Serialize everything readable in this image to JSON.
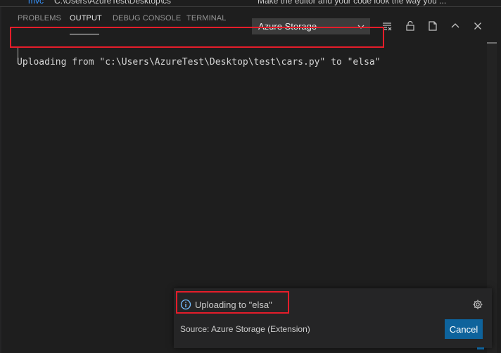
{
  "background_editor": {
    "project_name": "mvc",
    "project_path": "C:\\Users\\AzureTest\\Desktop\\cs",
    "tip_text": "Make the editor and your code look the way you ..."
  },
  "panel": {
    "tabs": [
      {
        "label": "PROBLEMS",
        "active": false
      },
      {
        "label": "OUTPUT",
        "active": true
      },
      {
        "label": "DEBUG CONSOLE",
        "active": false
      },
      {
        "label": "TERMINAL",
        "active": false
      }
    ],
    "channel_select": {
      "value": "Azure Storage"
    },
    "actions": [
      {
        "name": "clear-output-icon"
      },
      {
        "name": "lock-scroll-icon"
      },
      {
        "name": "open-in-editor-icon"
      },
      {
        "name": "maximize-panel-icon"
      },
      {
        "name": "close-panel-icon"
      }
    ]
  },
  "output": {
    "lines": [
      "Uploading from \"c:\\Users\\AzureTest\\Desktop\\test\\cars.py\" to \"elsa\""
    ]
  },
  "notification": {
    "message": "Uploading to \"elsa\"",
    "source": "Source: Azure Storage (Extension)",
    "button_label": "Cancel"
  },
  "colors": {
    "background": "#1e1e1e",
    "highlight_red": "#e51d2a",
    "button_blue": "#0e639c",
    "info_blue": "#75beff"
  }
}
